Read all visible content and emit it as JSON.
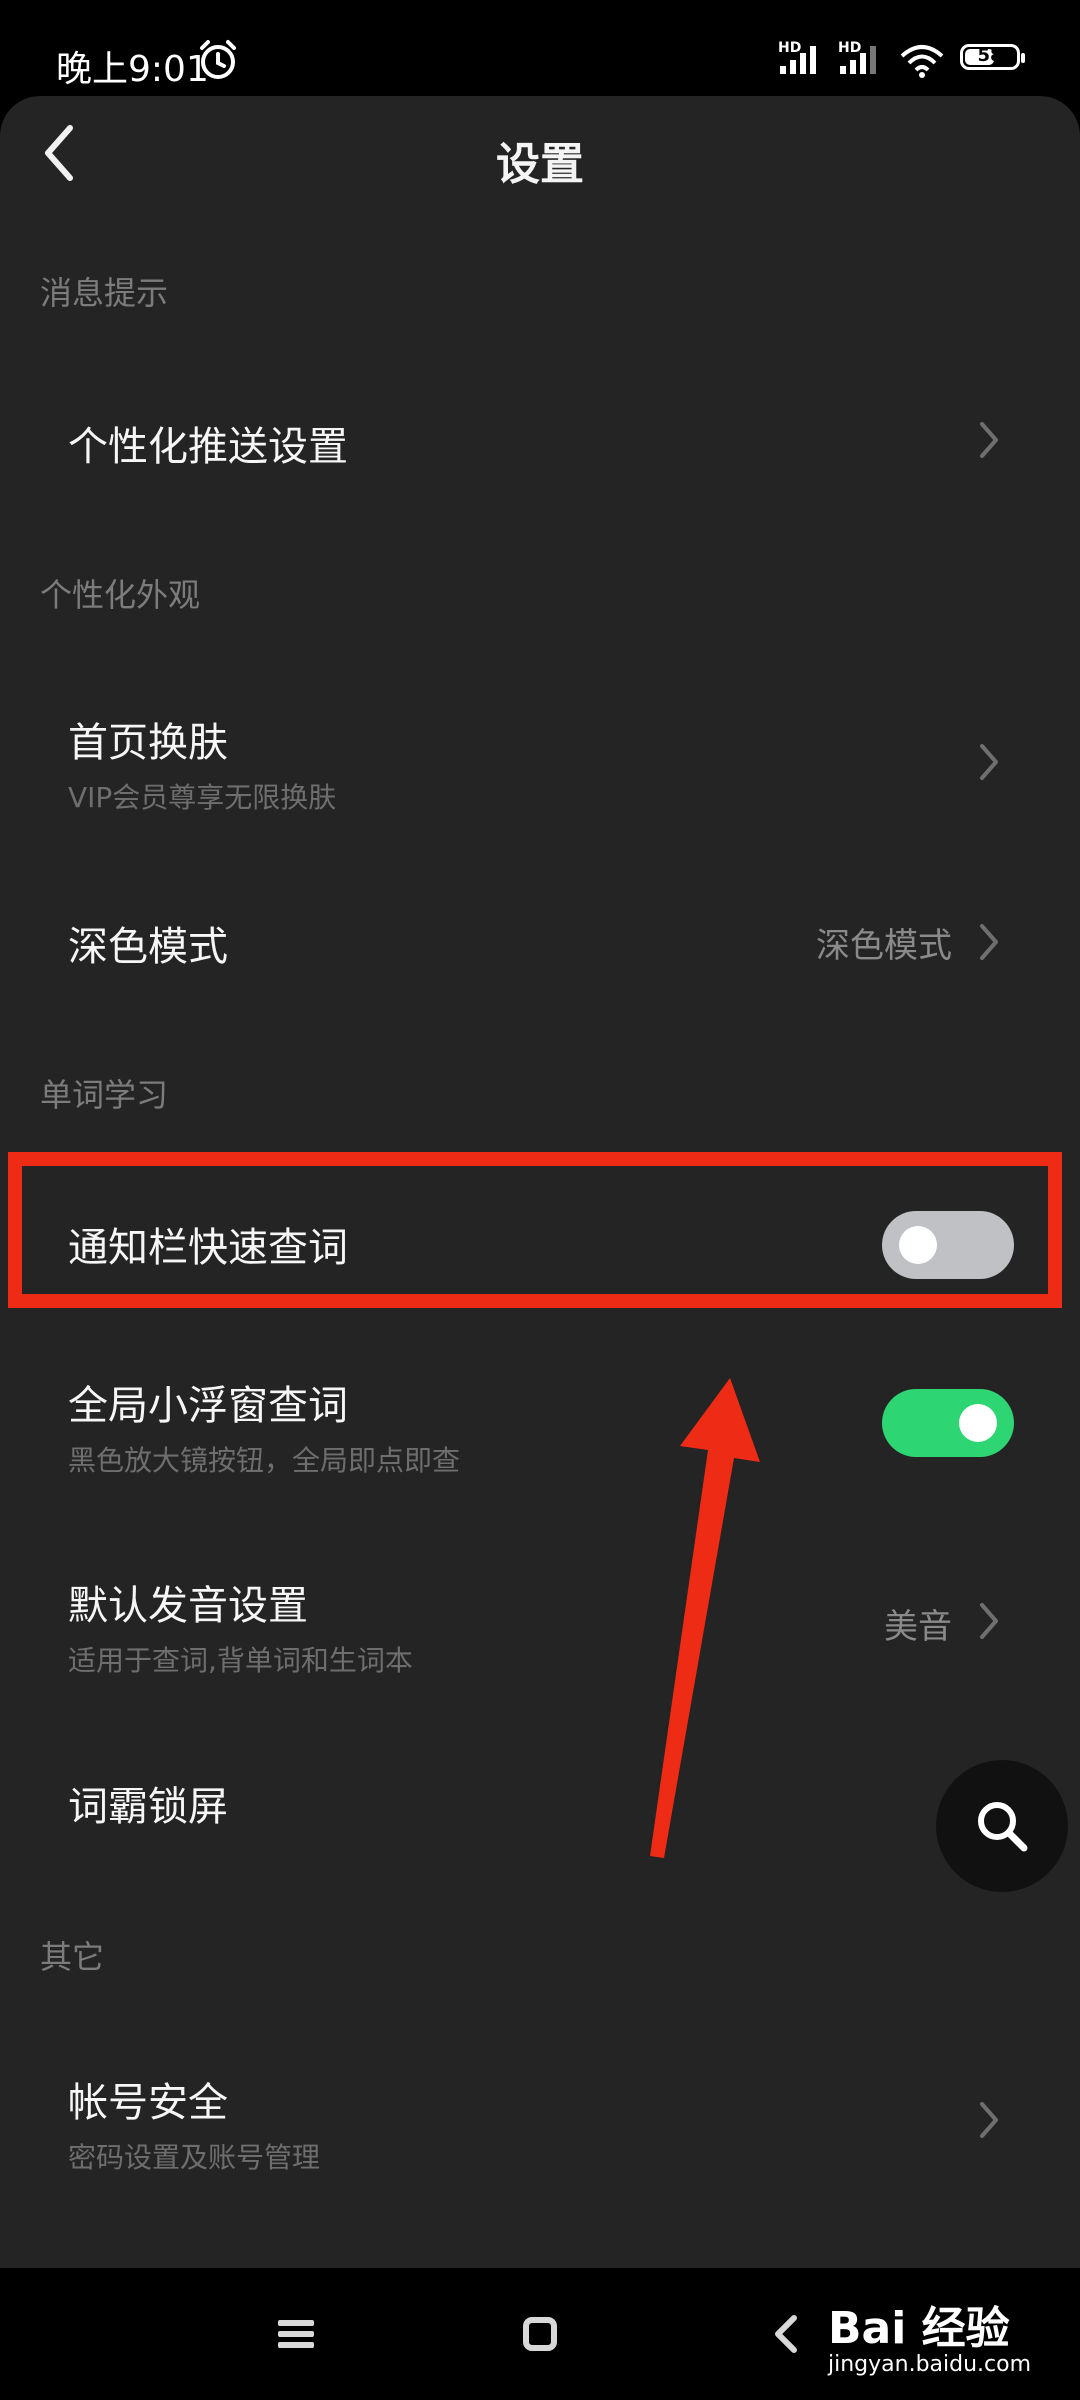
{
  "status_bar": {
    "time": "晚上9:01",
    "battery": "58",
    "battery_level": 0.58,
    "signal1_label": "HD",
    "signal2_label": "HD"
  },
  "header": {
    "title": "设置"
  },
  "sections": {
    "msg": {
      "label": "消息提示"
    },
    "look": {
      "label": "个性化外观"
    },
    "word": {
      "label": "单词学习"
    },
    "other": {
      "label": "其它"
    }
  },
  "rows": {
    "push": {
      "title": "个性化推送设置"
    },
    "skin": {
      "title": "首页换肤",
      "subtitle": "VIP会员尊享无限换肤"
    },
    "dark": {
      "title": "深色模式",
      "value": "深色模式"
    },
    "notif": {
      "title": "通知栏快速查词",
      "enabled": false
    },
    "float": {
      "title": "全局小浮窗查词",
      "subtitle": "黑色放大镜按钮，全局即点即查",
      "enabled": true
    },
    "voice": {
      "title": "默认发音设置",
      "subtitle": "适用于查词,背单词和生词本",
      "value": "美音"
    },
    "lock": {
      "title": "词霸锁屏"
    },
    "account": {
      "title": "帐号安全",
      "subtitle": "密码设置及账号管理"
    }
  },
  "watermark": {
    "brand": "Bai 经验",
    "url": "jingyan.baidu.com"
  },
  "colors": {
    "highlight": "#ee2b14",
    "toggle_on": "#2ed573",
    "toggle_off": "#bfc1c5",
    "panel_bg": "#242424"
  }
}
